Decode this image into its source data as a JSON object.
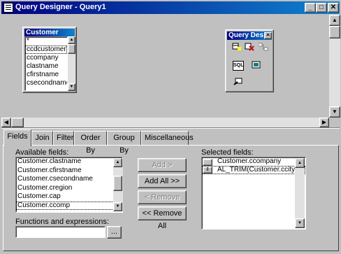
{
  "window": {
    "title": "Query Designer - Query1",
    "controls": [
      "_",
      "□",
      "✕"
    ]
  },
  "table_window": {
    "title": "Customer",
    "fields": [
      "*",
      "ccdcustomer",
      "ccompany",
      "clastname",
      "cfirstname",
      "csecondname"
    ]
  },
  "toolbox": {
    "title": "Query Des",
    "close": "✕"
  },
  "tabs": [
    "Fields",
    "Join",
    "Filter",
    "Order By",
    "Group By",
    "Miscellaneous"
  ],
  "fields_tab": {
    "available_label": "Available fields:",
    "available_fields": [
      "Customer.clastname",
      "Customer.cfirstname",
      "Customer.csecondname",
      "Customer.cregion",
      "Customer.cap",
      "Customer.ccomp"
    ],
    "selected_label": "Selected fields:",
    "selected_fields": [
      "Customer.ccompany",
      "AL_TRIM(Customer.ccityld"
    ],
    "functions_label": "Functions and expressions:",
    "functions_value": "",
    "browse_label": "...",
    "buttons": {
      "add": "Add >",
      "add_all": "Add All >>",
      "remove": "< Remove",
      "remove_all": "<< Remove All"
    }
  }
}
